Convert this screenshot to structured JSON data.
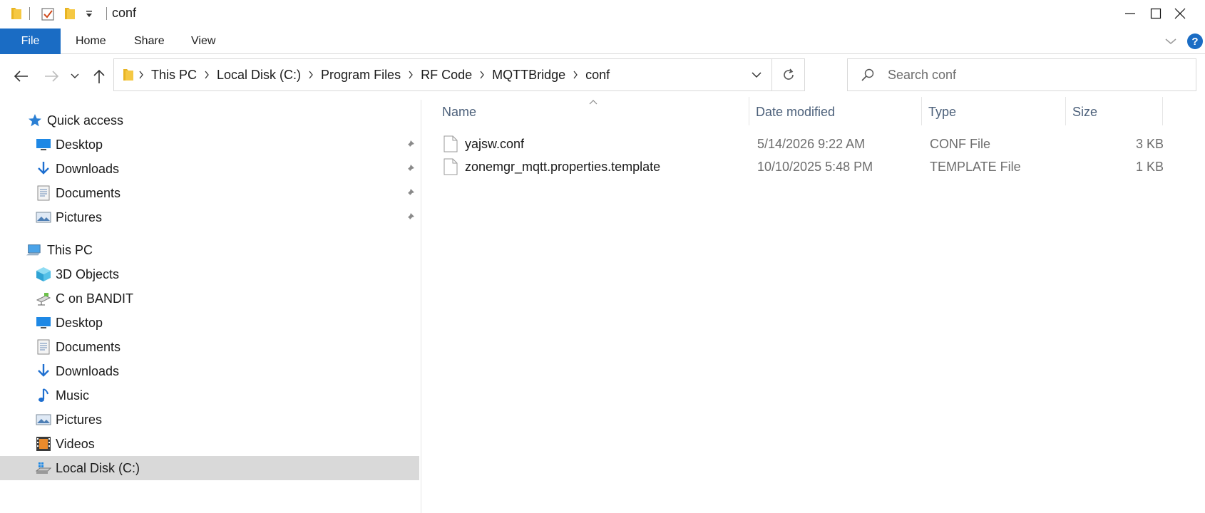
{
  "window": {
    "title": "conf"
  },
  "ribbon": {
    "tabs": [
      {
        "label": "File"
      },
      {
        "label": "Home"
      },
      {
        "label": "Share"
      },
      {
        "label": "View"
      }
    ],
    "help_label": "?"
  },
  "address": {
    "crumbs": [
      "This PC",
      "Local Disk (C:)",
      "Program Files",
      "RF Code",
      "MQTTBridge",
      "conf"
    ]
  },
  "search": {
    "placeholder": "Search conf"
  },
  "nav": {
    "quick_access": {
      "label": "Quick access",
      "items": [
        {
          "label": "Desktop",
          "icon": "desktop-icon",
          "pinned": true
        },
        {
          "label": "Downloads",
          "icon": "downloads-icon",
          "pinned": true
        },
        {
          "label": "Documents",
          "icon": "documents-icon",
          "pinned": true
        },
        {
          "label": "Pictures",
          "icon": "pictures-icon",
          "pinned": true
        }
      ]
    },
    "this_pc": {
      "label": "This PC",
      "items": [
        {
          "label": "3D Objects",
          "icon": "3d-objects-icon"
        },
        {
          "label": "C on BANDIT",
          "icon": "network-drive-icon"
        },
        {
          "label": "Desktop",
          "icon": "desktop-icon"
        },
        {
          "label": "Documents",
          "icon": "documents-icon"
        },
        {
          "label": "Downloads",
          "icon": "downloads-icon"
        },
        {
          "label": "Music",
          "icon": "music-icon"
        },
        {
          "label": "Pictures",
          "icon": "pictures-icon"
        },
        {
          "label": "Videos",
          "icon": "videos-icon"
        },
        {
          "label": "Local Disk (C:)",
          "icon": "local-disk-icon",
          "selected": true
        }
      ]
    }
  },
  "files": {
    "columns": [
      "Name",
      "Date modified",
      "Type",
      "Size"
    ],
    "sorted_by": "Name",
    "rows": [
      {
        "name": "yajsw.conf",
        "date": "5/14/2026 9:22 AM",
        "type": "CONF File",
        "size": "3 KB"
      },
      {
        "name": "zonemgr_mqtt.properties.template",
        "date": "10/10/2025 5:48 PM",
        "type": "TEMPLATE File",
        "size": "1 KB"
      }
    ]
  },
  "colors": {
    "accent": "#1a6cc4",
    "selected_row": "#d9d9d9",
    "header_text": "#4c607a",
    "secondary_text": "#6d6d6d",
    "folder": "#f5c843"
  }
}
